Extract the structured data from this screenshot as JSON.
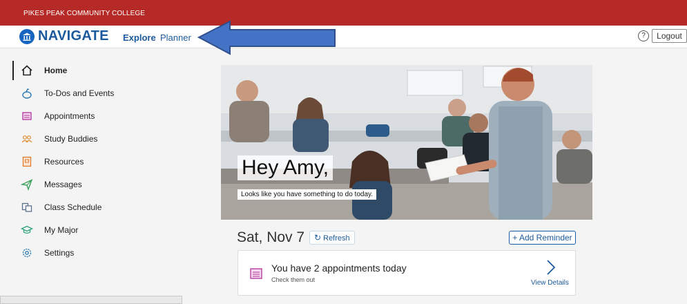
{
  "header": {
    "college_name": "PIKES PEAK COMMUNITY COLLEGE",
    "app_title": "NAVIGATE",
    "nav_explore": "Explore",
    "nav_planner": "Planner",
    "help_symbol": "?",
    "logout_label": "Logout"
  },
  "sidebar": {
    "items": [
      {
        "label": "Home",
        "icon": "home-icon",
        "active": true
      },
      {
        "label": "To-Dos and Events",
        "icon": "todo-icon"
      },
      {
        "label": "Appointments",
        "icon": "appointments-icon"
      },
      {
        "label": "Study Buddies",
        "icon": "study-buddies-icon"
      },
      {
        "label": "Resources",
        "icon": "resources-icon"
      },
      {
        "label": "Messages",
        "icon": "messages-icon"
      },
      {
        "label": "Class Schedule",
        "icon": "class-schedule-icon"
      },
      {
        "label": "My Major",
        "icon": "graduation-cap-icon"
      },
      {
        "label": "Settings",
        "icon": "gear-icon"
      }
    ]
  },
  "hero": {
    "greeting": "Hey Amy,",
    "subtext": "Looks like you have something to do today."
  },
  "main": {
    "date": "Sat, Nov 7",
    "refresh_label": "Refresh",
    "add_reminder_label": "+ Add Reminder",
    "appointment_card": {
      "title": "You have 2 appointments today",
      "subtitle": "Check them out",
      "link": "View Details"
    }
  },
  "colors": {
    "brand_red": "#b52a26",
    "brand_blue": "#1b5a9c",
    "arrow_blue": "#4472c4"
  }
}
